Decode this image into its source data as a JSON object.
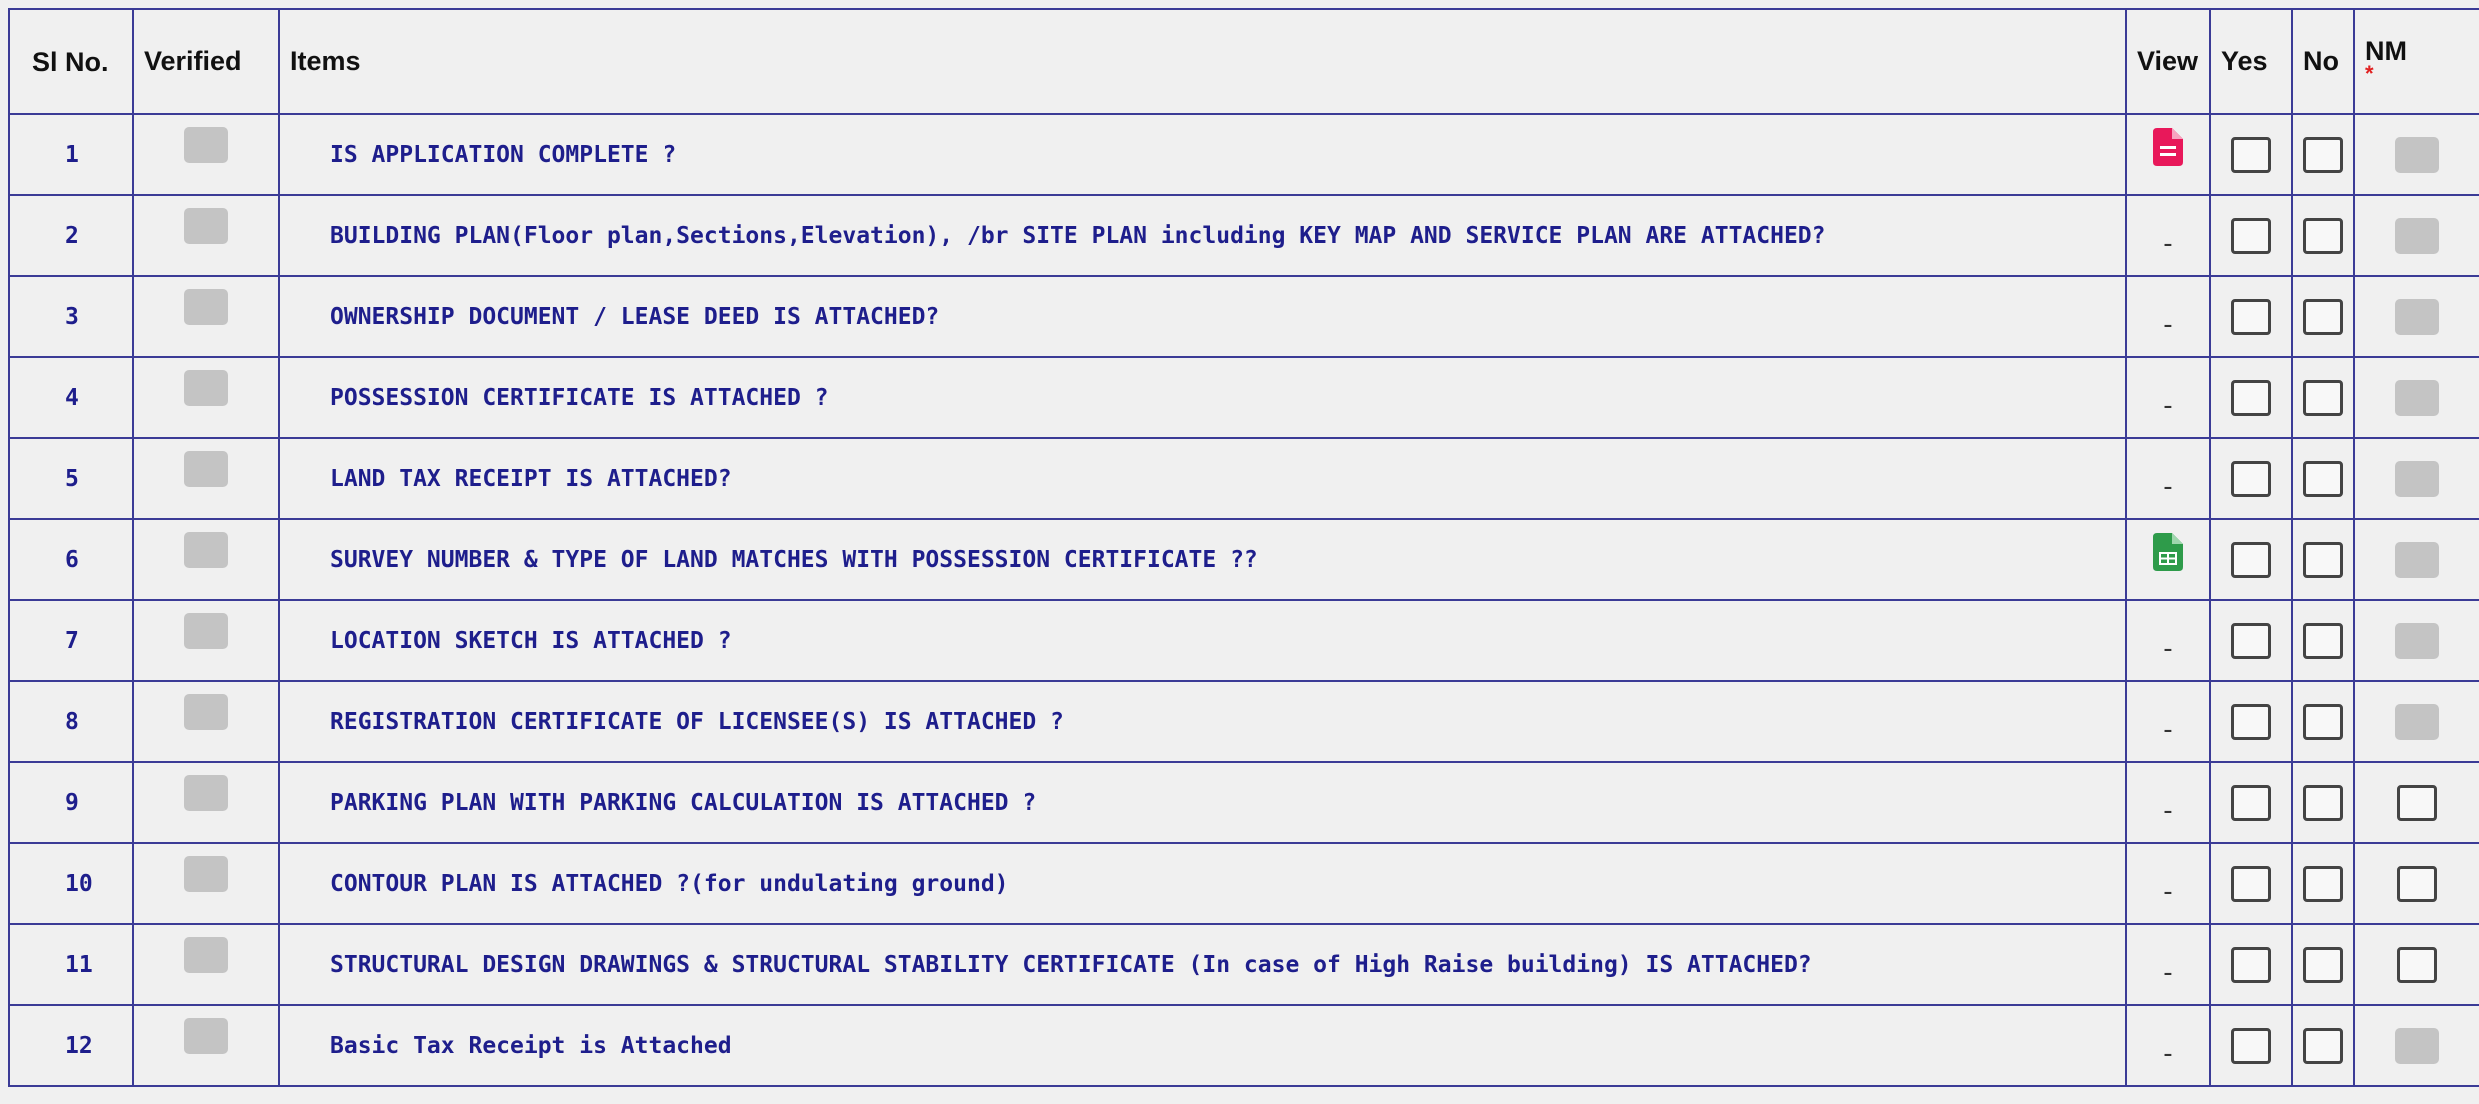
{
  "headers": {
    "sl": "Sl No.",
    "verified": "Verified",
    "items": "Items",
    "view": "View",
    "yes": "Yes",
    "no": "No",
    "nm": "NM",
    "nm_required": "*"
  },
  "rows": [
    {
      "sl": "1",
      "item": "IS APPLICATION COMPLETE ?",
      "view": "pdf-document-icon",
      "nm": "disabled"
    },
    {
      "sl": "2",
      "item": "BUILDING PLAN(Floor plan,Sections,Elevation), /br SITE PLAN including KEY MAP AND SERVICE PLAN ARE ATTACHED?",
      "view": "-",
      "nm": "disabled"
    },
    {
      "sl": "3",
      "item": "OWNERSHIP DOCUMENT / LEASE DEED IS ATTACHED?",
      "view": "-",
      "nm": "disabled"
    },
    {
      "sl": "4",
      "item": "POSSESSION CERTIFICATE IS ATTACHED ?",
      "view": "-",
      "nm": "disabled"
    },
    {
      "sl": "5",
      "item": "LAND TAX RECEIPT IS ATTACHED?",
      "view": "-",
      "nm": "disabled"
    },
    {
      "sl": "6",
      "item": "SURVEY NUMBER & TYPE OF LAND MATCHES WITH POSSESSION CERTIFICATE ??",
      "view": "spreadsheet-document-icon",
      "nm": "disabled"
    },
    {
      "sl": "7",
      "item": "LOCATION SKETCH IS ATTACHED ?",
      "view": "-",
      "nm": "disabled"
    },
    {
      "sl": "8",
      "item": "REGISTRATION CERTIFICATE OF LICENSEE(S) IS ATTACHED ?",
      "view": "-",
      "nm": "disabled"
    },
    {
      "sl": "9",
      "item": "PARKING PLAN WITH PARKING CALCULATION IS ATTACHED ?",
      "view": "-",
      "nm": "enabled"
    },
    {
      "sl": "10",
      "item": "CONTOUR PLAN IS ATTACHED ?(for undulating ground)",
      "view": "-",
      "nm": "enabled"
    },
    {
      "sl": "11",
      "item": "STRUCTURAL DESIGN DRAWINGS & STRUCTURAL STABILITY CERTIFICATE (In case of High Raise building) IS ATTACHED?",
      "view": "-",
      "nm": "enabled"
    },
    {
      "sl": "12",
      "item": "Basic Tax Receipt is Attached",
      "view": "-",
      "nm": "disabled"
    }
  ],
  "colors": {
    "border": "#3b3b96",
    "item_text": "#1e1e8c",
    "pdf_icon": "#e8185a",
    "sheet_icon": "#2e9b4a",
    "disabled_box": "#c4c4c4"
  }
}
